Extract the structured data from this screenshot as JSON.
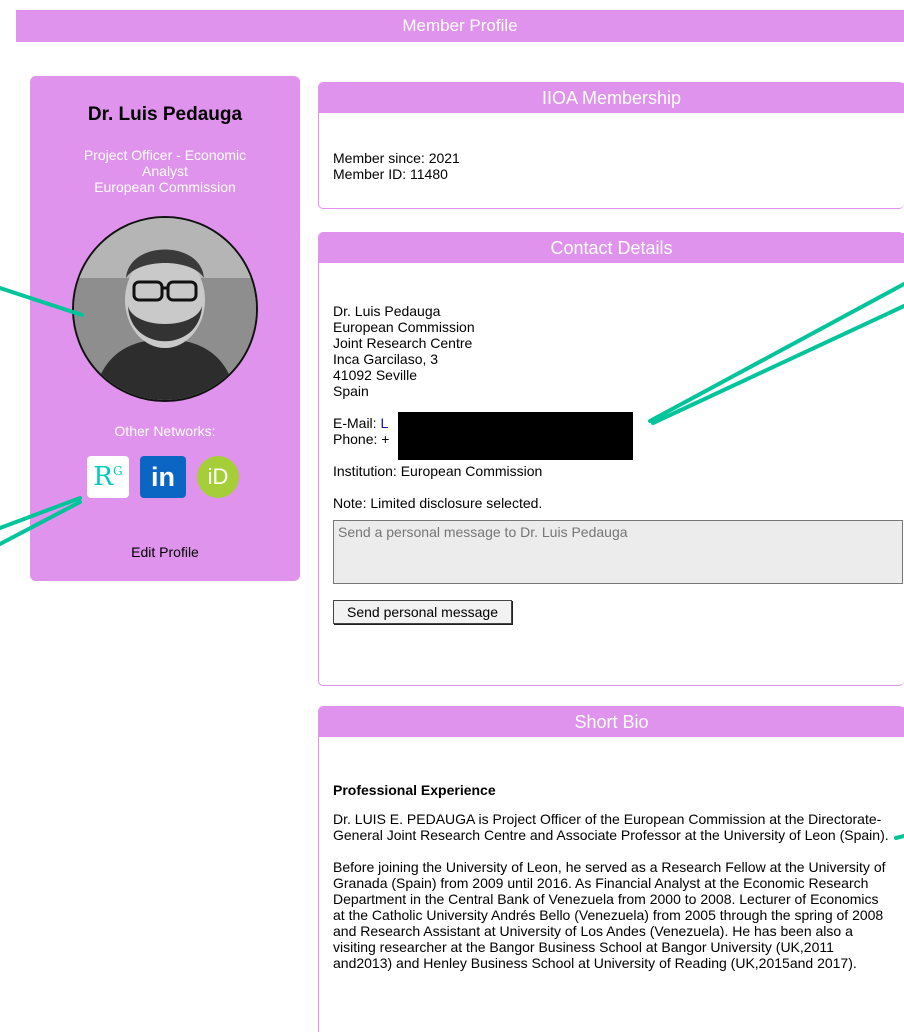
{
  "page": {
    "title": "Member Profile"
  },
  "profile": {
    "name": "Dr. Luis Pedauga",
    "role_line1": "Project Officer - Economic",
    "role_line2": "Analyst",
    "organization": "European Commission",
    "networks_title": "Other Networks:",
    "networks": [
      "ResearchGate",
      "LinkedIn",
      "ORCID"
    ],
    "edit_label": "Edit Profile"
  },
  "membership": {
    "title": "IIOA Membership",
    "member_since": "Member since: 2021",
    "member_id": "Member ID: 11480"
  },
  "contact": {
    "title": "Contact Details",
    "address": [
      "Dr. Luis Pedauga",
      "European Commission",
      "Joint Research Centre",
      "Inca Garcilaso, 3",
      "41092 Seville",
      "Spain"
    ],
    "email_label": "E-Mail: ",
    "email_visible": "L",
    "phone_label": "Phone: +",
    "institution": "Institution: European Commission",
    "note": "Note: Limited disclosure selected.",
    "message_placeholder": "Send a personal message to Dr. Luis Pedauga",
    "send_label": "Send personal message"
  },
  "bio": {
    "title": "Short Bio",
    "heading": "Professional Experience",
    "paragraph1": "Dr. LUIS E. PEDAUGA is Project Officer of the European Commission at the Directorate-General Joint Research Centre and Associate Professor at the University of Leon (Spain).",
    "paragraph2": "Before joining the University of Leon, he served as a Research Fellow at the University of Granada (Spain) from 2009 until 2016. As Financial Analyst at the Economic Research Department in the Central Bank of Venezuela from 2000 to 2008. Lecturer of Economics at the Catholic University Andrés Bello (Venezuela) from 2005 through the spring of 2008 and Research Assistant at University of Los Andes (Venezuela). He has been also a visiting researcher at the Bangor Business School at Bangor University (UK,2011 and2013) and Henley Business School at University of Reading (UK,2015and 2017)."
  },
  "colors": {
    "accent": "#df93ec",
    "annotation": "#00c49a",
    "redaction": "#000000"
  }
}
